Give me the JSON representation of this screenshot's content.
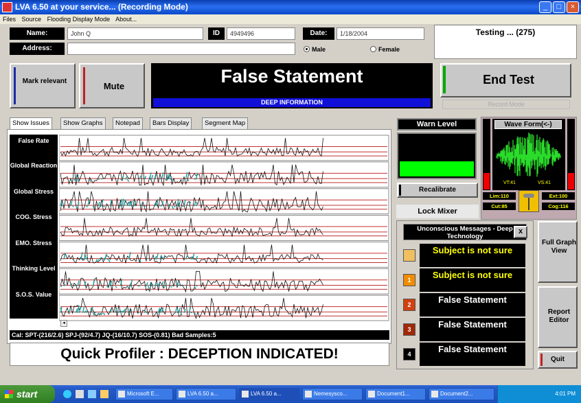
{
  "window": {
    "title": "LVA 6.50 at your service... (Recording Mode)"
  },
  "menu": [
    "Files",
    "Source",
    "Flooding Display Mode",
    "About..."
  ],
  "subject": {
    "name_label": "Name:",
    "name_value": "John Q",
    "id_label": "ID",
    "id_value": "4949496",
    "date_label": "Date:",
    "date_value": "1/18/2004",
    "address_label": "Address:",
    "address_value": "",
    "gender_options": [
      "Male",
      "Female"
    ],
    "gender_selected": "Male"
  },
  "testing_status": "Testing ... (275)",
  "buttons": {
    "mark_relevant": "Mark relevant",
    "mute": "Mute",
    "end_test": "End Test",
    "record_mode": "Record Mode",
    "recalibrate": "Recalibrate",
    "lock_mixer": "Lock Mixer",
    "full_graph_view": "Full Graph View",
    "report_editor": "Report Editor",
    "quit": "Quit",
    "close_messages": "x"
  },
  "result": {
    "headline": "False Statement",
    "sub": "DEEP INFORMATION"
  },
  "tabs": [
    "Show Issues",
    "Show Graphs",
    "Notepad",
    "Bars Display",
    "Segment Map"
  ],
  "active_tab": "Show Issues",
  "graph_rows": [
    "False Rate",
    "Global Reaction",
    "Global Stress",
    "COG. Stress",
    "EMO. Stress",
    "Thinking Level",
    "S.O.S. Value"
  ],
  "graph_readout": "Cal: SPT-(216/2.6) SPJ-(92/4.7) JQ-(16/10.7) SOS-(0.81) Bad Samples:5",
  "quick_profiler": "Quick Profiler : DECEPTION INDICATED!",
  "warn_level_label": "Warn Level",
  "waveform": {
    "label": "Wave Form(<-)",
    "vt_left": "VT:41",
    "vt_right": "VS:41"
  },
  "mixer": {
    "lim": "Lim:110",
    "ext": "Ext:100",
    "cut": "Cut:85",
    "cog": "Cog:116"
  },
  "messages": {
    "title": "Unconscious Messages - Deep Technology",
    "items": [
      {
        "num": "",
        "text": "Subject is not sure",
        "color": "#ffff00",
        "icon_color": "#f0c060"
      },
      {
        "num": "1",
        "text": "Subject is not sure",
        "color": "#ffff00",
        "icon_color": "#f08c00"
      },
      {
        "num": "2",
        "text": "False Statement",
        "color": "#ffffff",
        "icon_color": "#d04010"
      },
      {
        "num": "3",
        "text": "False Statement",
        "color": "#ffffff",
        "icon_color": "#a02808"
      },
      {
        "num": "4",
        "text": "False Statement",
        "color": "#ffffff",
        "icon_color": "#000000"
      }
    ]
  },
  "taskbar": {
    "start": "start",
    "tasks": [
      "Microsoft E...",
      "LVA 6.50 a...",
      "LVA 6.50 a...",
      "Nemesysco...",
      "Document1...",
      "Document2..."
    ],
    "clock": "4:01 PM"
  }
}
